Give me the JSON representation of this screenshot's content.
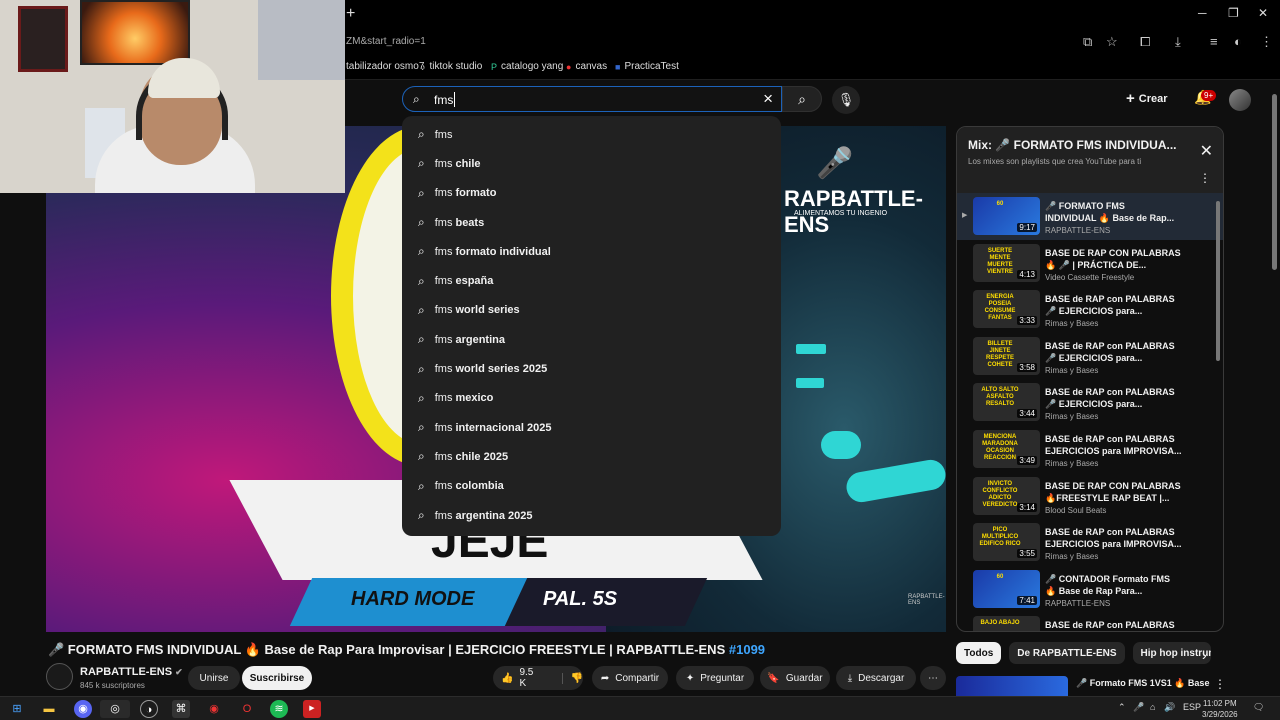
{
  "browser": {
    "url_fragment": "ZM&start_radio=1",
    "new_tab": "+",
    "bookmarks": [
      {
        "label": "tabilizador osmo7",
        "icon": ""
      },
      {
        "label": "tiktok studio",
        "icon": "♪"
      },
      {
        "label": "catalogo yang",
        "icon": "P"
      },
      {
        "label": "canvas",
        "icon": "●"
      },
      {
        "label": "PracticaTest",
        "icon": "■"
      }
    ]
  },
  "header": {
    "search_value": "fms",
    "create_label": "Crear",
    "notif_badge": "9+"
  },
  "suggestions": [
    {
      "prefix": "fms",
      "rest": ""
    },
    {
      "prefix": "fms",
      "rest": "chile"
    },
    {
      "prefix": "fms",
      "rest": "formato"
    },
    {
      "prefix": "fms",
      "rest": "beats"
    },
    {
      "prefix": "fms",
      "rest": "formato individual"
    },
    {
      "prefix": "fms",
      "rest": "españa"
    },
    {
      "prefix": "fms",
      "rest": "world series"
    },
    {
      "prefix": "fms",
      "rest": "argentina"
    },
    {
      "prefix": "fms",
      "rest": "world series 2025"
    },
    {
      "prefix": "fms",
      "rest": "mexico"
    },
    {
      "prefix": "fms",
      "rest": "internacional 2025"
    },
    {
      "prefix": "fms",
      "rest": "chile 2025"
    },
    {
      "prefix": "fms",
      "rest": "colombia"
    },
    {
      "prefix": "fms",
      "rest": "argentina 2025"
    }
  ],
  "video_overlay": {
    "logo": "RAPBATTLE-ENS",
    "logo_sub": "ALIMENTAMOS TU INGENIO",
    "banner_word": "JEJE",
    "hard_mode": "HARD MODE",
    "pal": "PAL. 5S",
    "corner": "RAPBATTLE-ENS"
  },
  "video": {
    "title": "🎤 FORMATO FMS INDIVIDUAL 🔥 Base de Rap Para Improvisar | EJERCICIO FREESTYLE | RAPBATTLE-ENS",
    "tag": "#1099",
    "channel": "RAPBATTLE-ENS",
    "verified": "✔",
    "subscribers": "845 k suscriptores",
    "join": "Unirse",
    "subscribe": "Suscribirse",
    "likes": "9.5 K",
    "share": "Compartir",
    "ask": "Preguntar",
    "save": "Guardar",
    "download": "Descargar"
  },
  "playlist": {
    "title": "Mix: 🎤 FORMATO FMS INDIVIDUA...",
    "subtitle": "Los mixes son playlists que crea YouTube para ti",
    "items": [
      {
        "line1": "🎤 FORMATO FMS",
        "line2": "INDIVIDUAL 🔥 Base de Rap...",
        "channel": "RAPBATTLE-ENS",
        "duration": "9:17",
        "thumb": "60",
        "active": true
      },
      {
        "line1": "BASE DE RAP CON PALABRAS",
        "line2": "🔥 🎤 | PRÁCTICA DE...",
        "channel": "Video Cassette Freestyle",
        "duration": "4:13",
        "thumb": "SUERTE MENTE MUERTE VIENTRE",
        "active": false
      },
      {
        "line1": "BASE de RAP con PALABRAS",
        "line2": "🎤 EJERCICIOS para...",
        "channel": "Rimas y Bases",
        "duration": "3:33",
        "thumb": "ENERGIA POSEIA CONSUME FANTAS",
        "active": false
      },
      {
        "line1": "BASE de RAP con PALABRAS",
        "line2": "🎤 EJERCICIOS para...",
        "channel": "Rimas y Bases",
        "duration": "3:58",
        "thumb": "BILLETE JINETE RESPETE COHETE",
        "active": false
      },
      {
        "line1": "BASE de RAP con PALABRAS",
        "line2": "🎤 EJERCICIOS para...",
        "channel": "Rimas y Bases",
        "duration": "3:44",
        "thumb": "ALTO SALTO ASFALTO RESALTO",
        "active": false
      },
      {
        "line1": "BASE de RAP con PALABRAS",
        "line2": "EJERCICIOS para IMPROVISA...",
        "channel": "Rimas y Bases",
        "duration": "3:49",
        "thumb": "MENCIONA MARADONA OCASION REACCION",
        "active": false
      },
      {
        "line1": "BASE DE RAP CON PALABRAS",
        "line2": "🔥FREESTYLE RAP BEAT |...",
        "channel": "Blood Soul Beats",
        "duration": "3:14",
        "thumb": "INVICTO CONFLICTO ADICTO VEREDICTO",
        "active": false
      },
      {
        "line1": "BASE de RAP con PALABRAS",
        "line2": "EJERCICIOS para IMPROVISA...",
        "channel": "Rimas y Bases",
        "duration": "3:55",
        "thumb": "PICO MULTIPLICO EDIFICO RICO",
        "active": false
      },
      {
        "line1": "🎤 CONTADOR Formato FMS",
        "line2": "🔥 Base de Rap Para...",
        "channel": "RAPBATTLE-ENS",
        "duration": "7:41",
        "thumb": "60",
        "active": false
      },
      {
        "line1": "BASE de RAP con PALABRAS",
        "line2": "",
        "channel": "",
        "duration": "",
        "thumb": "BAJO ABAJO",
        "active": false
      }
    ]
  },
  "chips": [
    "Todos",
    "De RAPBATTLE-ENS",
    "Hip hop instrume"
  ],
  "next_title": "🎤 Formato FMS 1VS1 🔥 Base",
  "taskbar": {
    "lang": "ESP",
    "time": "11:02 PM",
    "date": "3/29/2026",
    "notif": "1"
  }
}
